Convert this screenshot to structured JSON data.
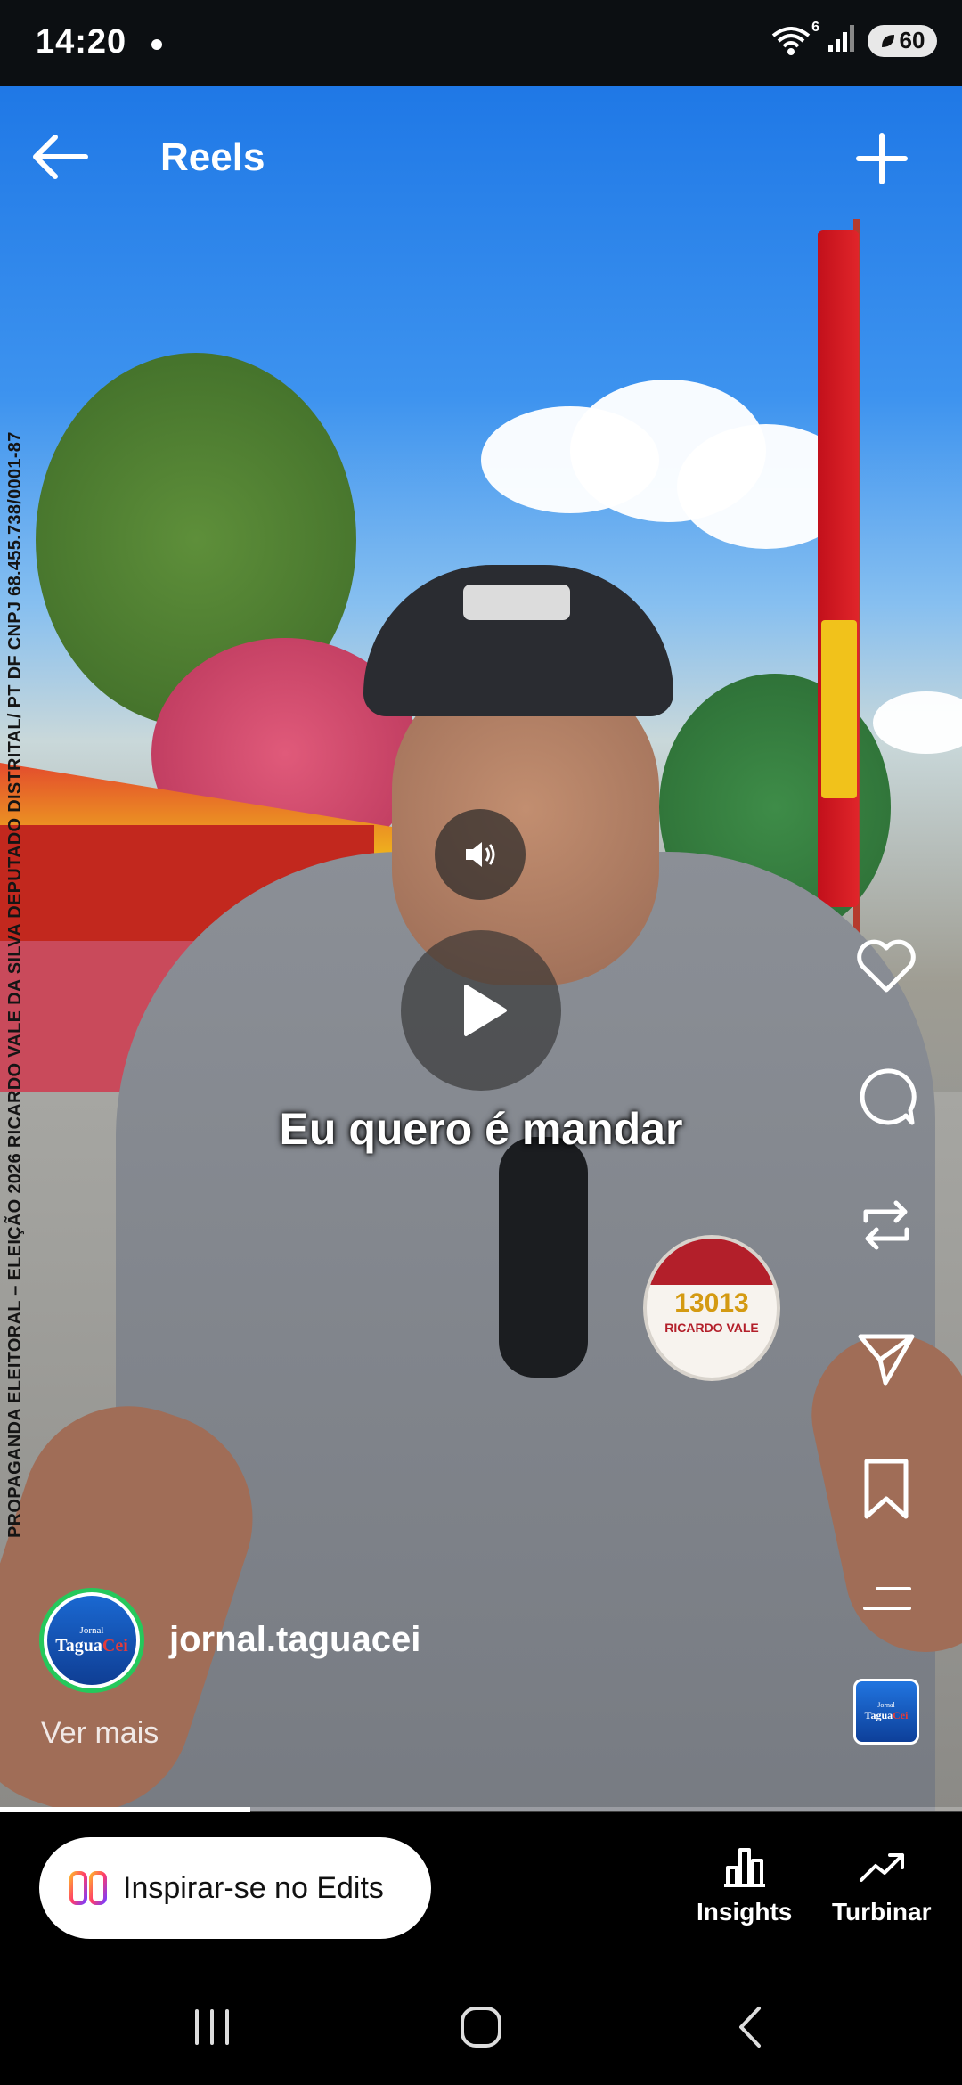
{
  "status_bar": {
    "time": "14:20",
    "wifi_badge": "6",
    "battery": "60"
  },
  "header": {
    "title": "Reels"
  },
  "video": {
    "caption": "Eu quero é mandar",
    "side_text": "PROPAGANDA ELEITORAL – ELEIÇÃO 2026 RICARDO VALE DA SILVA DEPUTADO DISTRITAL/ PT DF CNPJ 68.455.738/0001-87",
    "badge_number": "13013",
    "badge_name": "RICARDO VALE",
    "progress_percent": 26
  },
  "author": {
    "username": "jornal.taguacei",
    "avatar_line1": "Jornal",
    "avatar_line2a": "Tagua",
    "avatar_line2b": "Cei",
    "more_label": "Ver mais"
  },
  "bottom": {
    "edits_label": "Inspirar-se no Edits",
    "insights_label": "Insights",
    "boost_label": "Turbinar"
  },
  "icons": {
    "back": "arrow-left-icon",
    "add": "plus-icon",
    "like": "heart-icon",
    "comment": "comment-icon",
    "repost": "repost-icon",
    "share": "send-icon",
    "save": "bookmark-icon",
    "more": "menu-icon",
    "sound": "speaker-icon",
    "play": "play-icon"
  },
  "colors": {
    "avatar_ring": "#25c85b",
    "edits_gradient_a": "#ff3b6b",
    "edits_gradient_b": "#7a3cff"
  }
}
